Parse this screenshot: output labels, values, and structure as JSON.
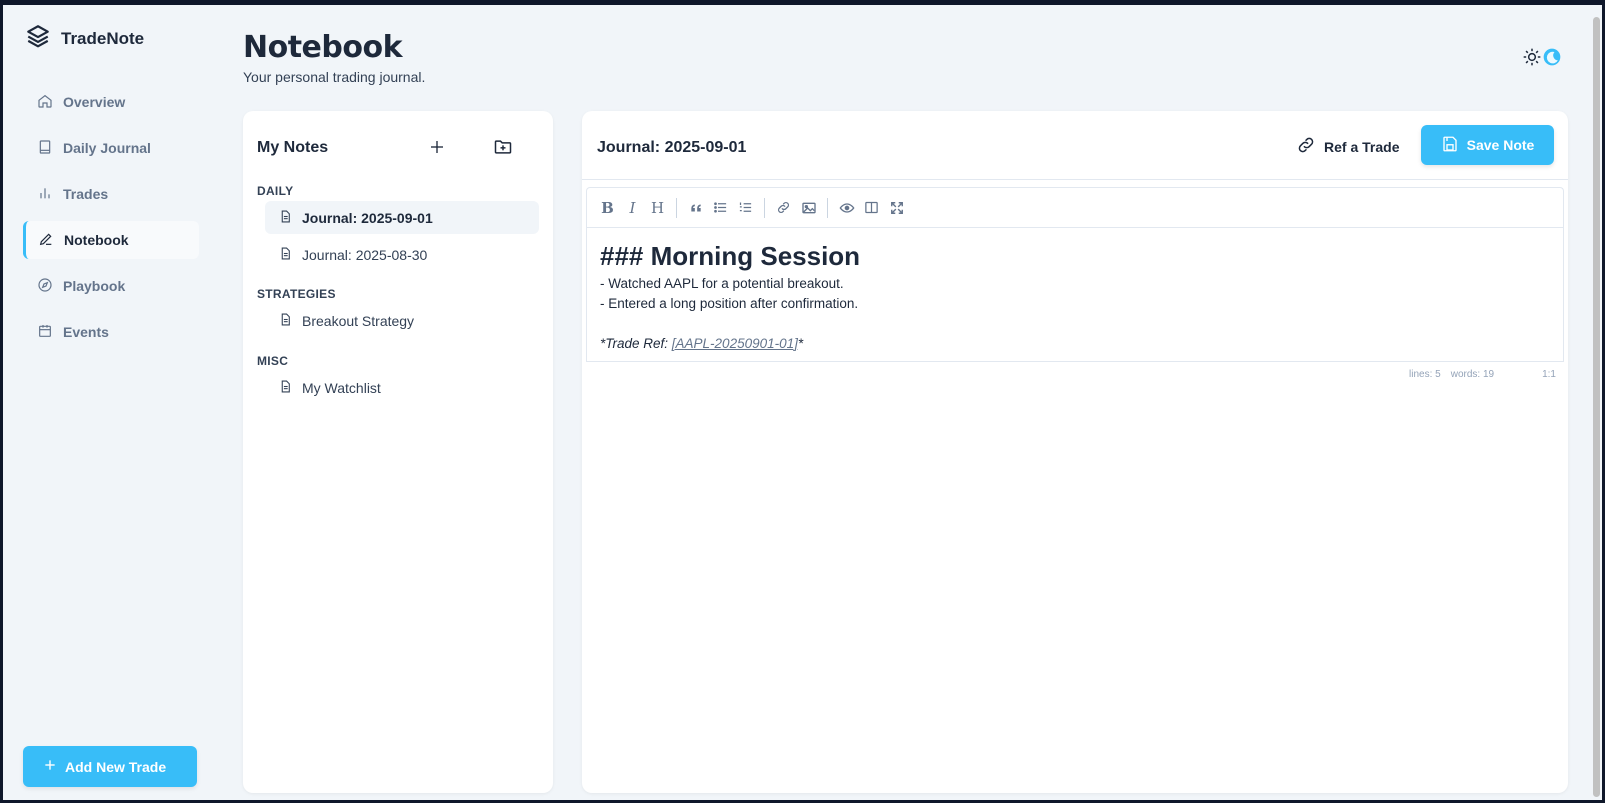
{
  "brand": {
    "name": "TradeNote",
    "icon": "layers-icon"
  },
  "nav": [
    {
      "label": "Overview",
      "icon": "home-icon",
      "active": false
    },
    {
      "label": "Daily Journal",
      "icon": "book-icon",
      "active": false
    },
    {
      "label": "Trades",
      "icon": "bar-chart-icon",
      "active": false
    },
    {
      "label": "Notebook",
      "icon": "pencil-icon",
      "active": true
    },
    {
      "label": "Playbook",
      "icon": "compass-icon",
      "active": false
    },
    {
      "label": "Events",
      "icon": "calendar-icon",
      "active": false
    }
  ],
  "add_trade_label": "Add New Trade",
  "header": {
    "title": "Notebook",
    "subtitle": "Your personal trading journal."
  },
  "notes": {
    "title": "My Notes",
    "sections": [
      {
        "label": "DAILY",
        "items": [
          "Journal: 2025-09-01",
          "Journal: 2025-08-30"
        ]
      },
      {
        "label": "STRATEGIES",
        "items": [
          "Breakout Strategy"
        ]
      },
      {
        "label": "MISC",
        "items": [
          "My Watchlist"
        ]
      }
    ],
    "active_item": "Journal: 2025-09-01"
  },
  "editor": {
    "title": "Journal: 2025-09-01",
    "ref_label": "Ref a Trade",
    "save_label": "Save Note",
    "content": {
      "heading": "### Morning Session",
      "line1": "- Watched AAPL for a potential breakout.",
      "line2": "- Entered a long position after confirmation.",
      "ref_prefix": "*Trade Ref: ",
      "ref_link": "[AAPL-20250901-01]",
      "ref_suffix": "*"
    },
    "status": {
      "lines": "lines: 5",
      "words": "words: 19",
      "cursor": "1:1"
    }
  },
  "colors": {
    "accent": "#38bdf8",
    "text": "#1e293b",
    "muted": "#64748b",
    "bg": "#f1f5f9"
  }
}
